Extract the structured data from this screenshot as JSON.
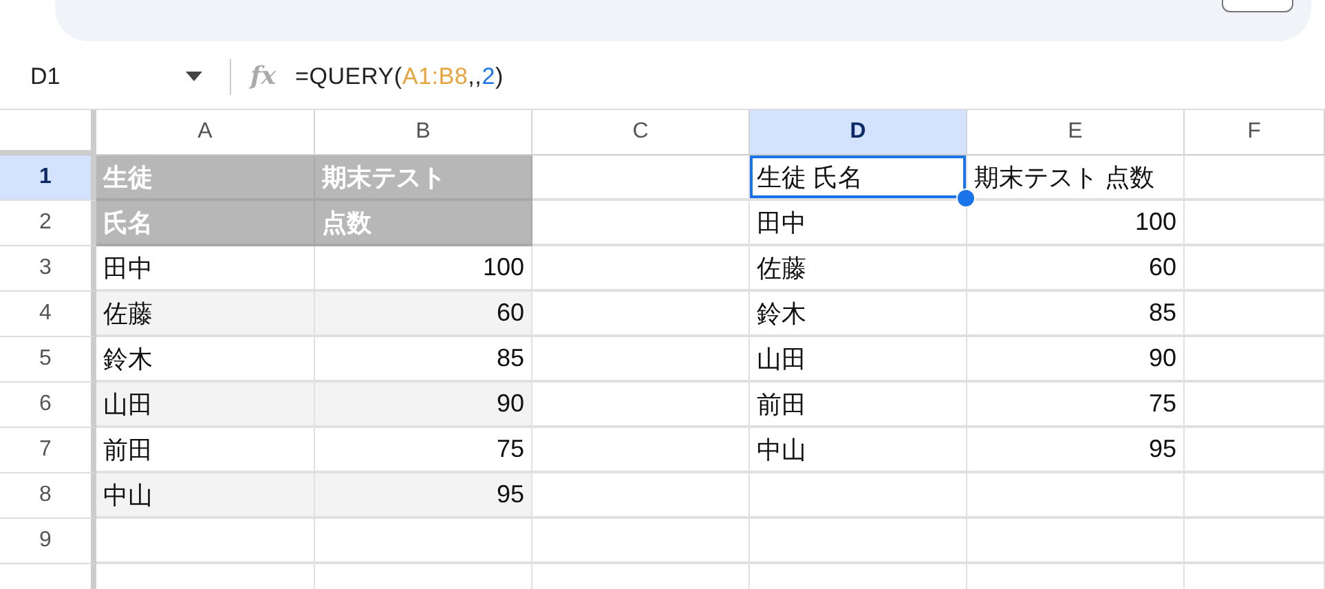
{
  "formula_bar": {
    "cell_ref": "D1",
    "fx": "fx",
    "formula": [
      {
        "kind": "plain",
        "text": "=QUERY("
      },
      {
        "kind": "range",
        "text": "A1:B8"
      },
      {
        "kind": "plain",
        "text": ",,"
      },
      {
        "kind": "number",
        "text": "2"
      },
      {
        "kind": "plain",
        "text": ")"
      }
    ]
  },
  "columns": [
    {
      "label": "A",
      "selected": false
    },
    {
      "label": "B",
      "selected": false
    },
    {
      "label": "C",
      "selected": false
    },
    {
      "label": "D",
      "selected": true
    },
    {
      "label": "E",
      "selected": false
    },
    {
      "label": "F",
      "selected": false
    }
  ],
  "rows": [
    {
      "label": "1",
      "selected": true,
      "kind": "header",
      "cells": {
        "A": {
          "text": "生徒",
          "kind": "text",
          "selected": false
        },
        "B": {
          "text": "期末テスト",
          "kind": "text",
          "selected": false
        },
        "D": {
          "text": "生徒 氏名",
          "kind": "text",
          "selected": true
        },
        "E": {
          "text": "期末テスト 点数",
          "kind": "text",
          "selected": false
        }
      }
    },
    {
      "label": "2",
      "selected": false,
      "kind": "header",
      "cells": {
        "A": {
          "text": "氏名",
          "kind": "text",
          "selected": false
        },
        "B": {
          "text": "点数",
          "kind": "text",
          "selected": false
        },
        "D": {
          "text": "田中",
          "kind": "text",
          "selected": false
        },
        "E": {
          "text": "100",
          "kind": "number",
          "selected": false
        }
      }
    },
    {
      "label": "3",
      "selected": false,
      "kind": "plain",
      "cells": {
        "A": {
          "text": "田中",
          "kind": "text",
          "selected": false
        },
        "B": {
          "text": "100",
          "kind": "number",
          "selected": false
        },
        "D": {
          "text": "佐藤",
          "kind": "text",
          "selected": false
        },
        "E": {
          "text": "60",
          "kind": "number",
          "selected": false
        }
      }
    },
    {
      "label": "4",
      "selected": false,
      "kind": "alt",
      "cells": {
        "A": {
          "text": "佐藤",
          "kind": "text",
          "selected": false
        },
        "B": {
          "text": "60",
          "kind": "number",
          "selected": false
        },
        "D": {
          "text": "鈴木",
          "kind": "text",
          "selected": false
        },
        "E": {
          "text": "85",
          "kind": "number",
          "selected": false
        }
      }
    },
    {
      "label": "5",
      "selected": false,
      "kind": "plain",
      "cells": {
        "A": {
          "text": "鈴木",
          "kind": "text",
          "selected": false
        },
        "B": {
          "text": "85",
          "kind": "number",
          "selected": false
        },
        "D": {
          "text": "山田",
          "kind": "text",
          "selected": false
        },
        "E": {
          "text": "90",
          "kind": "number",
          "selected": false
        }
      }
    },
    {
      "label": "6",
      "selected": false,
      "kind": "alt",
      "cells": {
        "A": {
          "text": "山田",
          "kind": "text",
          "selected": false
        },
        "B": {
          "text": "90",
          "kind": "number",
          "selected": false
        },
        "D": {
          "text": "前田",
          "kind": "text",
          "selected": false
        },
        "E": {
          "text": "75",
          "kind": "number",
          "selected": false
        }
      }
    },
    {
      "label": "7",
      "selected": false,
      "kind": "plain",
      "cells": {
        "A": {
          "text": "前田",
          "kind": "text",
          "selected": false
        },
        "B": {
          "text": "75",
          "kind": "number",
          "selected": false
        },
        "D": {
          "text": "中山",
          "kind": "text",
          "selected": false
        },
        "E": {
          "text": "95",
          "kind": "number",
          "selected": false
        }
      }
    },
    {
      "label": "8",
      "selected": false,
      "kind": "alt",
      "cells": {
        "A": {
          "text": "中山",
          "kind": "text",
          "selected": false
        },
        "B": {
          "text": "95",
          "kind": "number",
          "selected": false
        }
      }
    },
    {
      "label": "9",
      "selected": false,
      "kind": "plain",
      "cells": {}
    }
  ]
}
